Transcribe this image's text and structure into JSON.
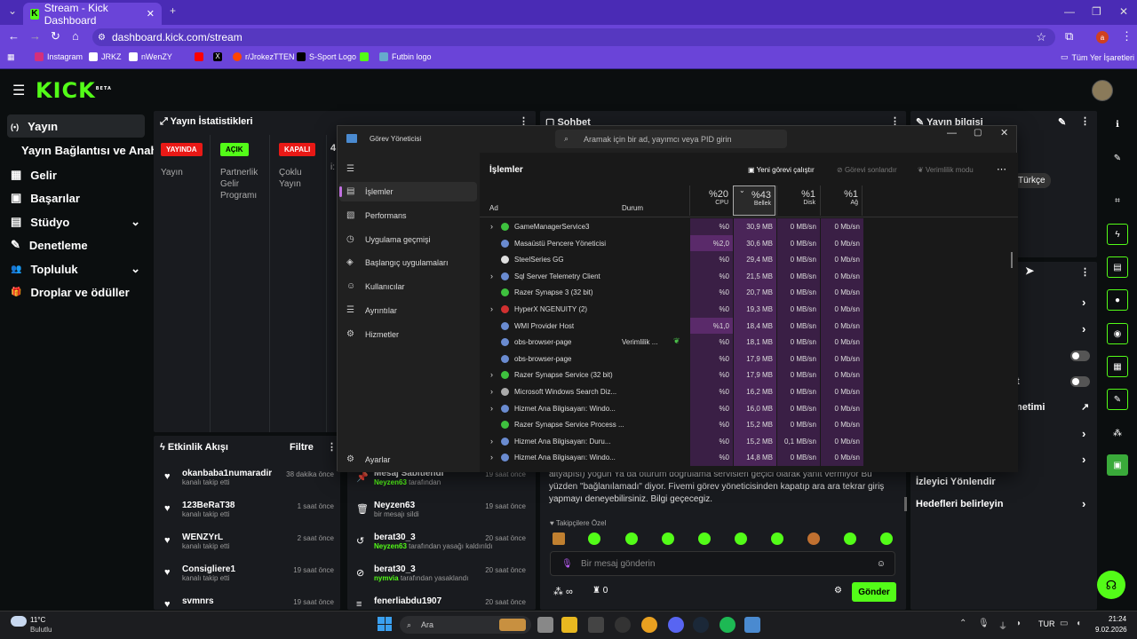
{
  "browser": {
    "tab_title": "Stream - Kick Dashboard",
    "url": "dashboard.kick.com/stream",
    "new_tab": "+",
    "bookmarks": [
      "Instagram",
      "JRKZ",
      "nWenZY",
      "",
      "r/JrokezTTEN",
      "S-Sport Logo",
      "",
      "Futbin logo"
    ],
    "all_bookmarks": "Tüm Yer İşaretleri",
    "profile_initial": "a"
  },
  "site": {
    "logo": "KICK",
    "logo_beta": "BETA"
  },
  "nav": {
    "items": [
      {
        "label": "Yayın",
        "icon": "(•)"
      },
      {
        "label": "Yayın Bağlantısı ve Anahtarı",
        "icon": ""
      },
      {
        "label": "Gelir",
        "icon": "▦"
      },
      {
        "label": "Başarılar",
        "icon": "▣"
      },
      {
        "label": "Stüdyo",
        "icon": "▤"
      },
      {
        "label": "Denetleme",
        "icon": "✎"
      },
      {
        "label": "Topluluk",
        "icon": "👥"
      },
      {
        "label": "Droplar ve ödüller",
        "icon": "🎁"
      }
    ]
  },
  "stats": {
    "title": "Yayın İstatistikleri",
    "badges": [
      {
        "label": "YAYINDA",
        "color": "#e91916"
      },
      {
        "label": "AÇIK",
        "color": "#53fc18"
      },
      {
        "label": "KAPALI",
        "color": "#e91916"
      }
    ],
    "values": [
      "4"
    ],
    "labels": [
      "Yayın",
      "Partnerlik Gelir Programı",
      "Çoklu Yayın"
    ],
    "extra": "i:"
  },
  "chat": {
    "title": "Sohbet",
    "body": "altyapısı) yoğun Ya da oturum doğrulama servisleri geçici olarak yanıt vermiyor Bu yüzden \"bağlanılamadı\" diyor. Fivemi görev yöneticisinden kapatıp ara ara tekrar giriş yapmayı deneyebilirsiniz. Bilgi geçecegiz.",
    "followers_label": "Takipçilere Özel",
    "placeholder": "Bir mesaj gönderin",
    "send": "Gönder",
    "count": "0"
  },
  "info": {
    "title": "Yayın bilgisi",
    "language": "Türkçe",
    "rows": [
      "Hedefleri belirleyin",
      "İzleyici Yönlendir",
      "netimi",
      "t"
    ]
  },
  "activity": {
    "title": "Etkinlik Akışı",
    "filter": "Filtre",
    "items": [
      {
        "name": "okanbaba1numaradir",
        "sub": "kanalı takip etti",
        "time": "38 dakika önce"
      },
      {
        "name": "123BeRaT38",
        "sub": "kanalı takip etti",
        "time": "1 saat önce"
      },
      {
        "name": "WENZYrL",
        "sub": "kanalı takip etti",
        "time": "2 saat önce"
      },
      {
        "name": "Consigliere1",
        "sub": "kanalı takip etti",
        "time": "19 saat önce"
      },
      {
        "name": "svmnrs",
        "sub": "",
        "time": "19 saat önce"
      }
    ]
  },
  "modlog": {
    "items": [
      {
        "name": "Mesaj Sabitlendi",
        "by": "Neyzen63",
        "sub": "tarafından",
        "time": "19 saat önce"
      },
      {
        "name": "Neyzen63",
        "by": "",
        "sub": "bir mesajı sildi",
        "time": "19 saat önce"
      },
      {
        "name": "berat30_3",
        "by": "Neyzen63",
        "sub": "tarafından yasağı kaldırıldı",
        "time": "20 saat önce"
      },
      {
        "name": "berat30_3",
        "by": "nymvia",
        "sub": "tarafından yasaklandı",
        "time": "20 saat önce"
      },
      {
        "name": "fenerliabdu1907",
        "by": "",
        "sub": "",
        "time": "20 saat önce"
      }
    ]
  },
  "taskmgr": {
    "title": "Görev Yöneticisi",
    "search": "Aramak için bir ad, yayımcı veya PID girin",
    "section": "İşlemler",
    "actions": [
      "Yeni görevi çalıştır",
      "Görevi sonlandır",
      "Verimlilik modu"
    ],
    "nav": [
      "İşlemler",
      "Performans",
      "Uygulama geçmişi",
      "Başlangıç uygulamaları",
      "Kullanıcılar",
      "Ayrıntılar",
      "Hizmetler"
    ],
    "settings": "Ayarlar",
    "headers": {
      "name": "Ad",
      "status": "Durum",
      "cpu_pct": "%20",
      "cpu": "CPU",
      "mem_pct": "%43",
      "mem": "Bellek",
      "disk_pct": "%1",
      "disk": "Disk",
      "net_pct": "%1",
      "net": "Ağ"
    },
    "rows": [
      {
        "name": "GameManagerService3",
        "status": "",
        "cpu": "%0",
        "mem": "30,9 MB",
        "disk": "0 MB/sn",
        "net": "0 Mb/sn",
        "exp": true,
        "ic": "#3ec13e"
      },
      {
        "name": "Masaüstü Pencere Yöneticisi",
        "status": "",
        "cpu": "%2,0",
        "mem": "30,6 MB",
        "disk": "0 MB/sn",
        "net": "0 Mb/sn",
        "exp": false,
        "ic": "#6a8bd0"
      },
      {
        "name": "SteelSeries GG",
        "status": "",
        "cpu": "%0",
        "mem": "29,4 MB",
        "disk": "0 MB/sn",
        "net": "0 Mb/sn",
        "exp": false,
        "ic": "#e0e0e0"
      },
      {
        "name": "Sql Server Telemetry Client",
        "status": "",
        "cpu": "%0",
        "mem": "21,5 MB",
        "disk": "0 MB/sn",
        "net": "0 Mb/sn",
        "exp": true,
        "ic": "#6a8bd0"
      },
      {
        "name": "Razer Synapse 3 (32 bit)",
        "status": "",
        "cpu": "%0",
        "mem": "20,7 MB",
        "disk": "0 MB/sn",
        "net": "0 Mb/sn",
        "exp": false,
        "ic": "#3ec13e"
      },
      {
        "name": "HyperX NGENUITY (2)",
        "status": "",
        "cpu": "%0",
        "mem": "19,3 MB",
        "disk": "0 MB/sn",
        "net": "0 Mb/sn",
        "exp": true,
        "ic": "#d03030"
      },
      {
        "name": "WMI Provider Host",
        "status": "",
        "cpu": "%1,0",
        "mem": "18,4 MB",
        "disk": "0 MB/sn",
        "net": "0 Mb/sn",
        "exp": false,
        "ic": "#6a8bd0"
      },
      {
        "name": "obs-browser-page",
        "status": "Verimlilik ...",
        "cpu": "%0",
        "mem": "18,1 MB",
        "disk": "0 MB/sn",
        "net": "0 Mb/sn",
        "exp": false,
        "ic": "#6a8bd0"
      },
      {
        "name": "obs-browser-page",
        "status": "",
        "cpu": "%0",
        "mem": "17,9 MB",
        "disk": "0 MB/sn",
        "net": "0 Mb/sn",
        "exp": false,
        "ic": "#6a8bd0"
      },
      {
        "name": "Razer Synapse Service (32 bit)",
        "status": "",
        "cpu": "%0",
        "mem": "17,9 MB",
        "disk": "0 MB/sn",
        "net": "0 Mb/sn",
        "exp": true,
        "ic": "#3ec13e"
      },
      {
        "name": "Microsoft Windows Search Diz...",
        "status": "",
        "cpu": "%0",
        "mem": "16,2 MB",
        "disk": "0 MB/sn",
        "net": "0 Mb/sn",
        "exp": true,
        "ic": "#aaa"
      },
      {
        "name": "Hizmet Ana Bilgisayarı: Windo...",
        "status": "",
        "cpu": "%0",
        "mem": "16,0 MB",
        "disk": "0 MB/sn",
        "net": "0 Mb/sn",
        "exp": true,
        "ic": "#6a8bd0"
      },
      {
        "name": "Razer Synapse Service Process ...",
        "status": "",
        "cpu": "%0",
        "mem": "15,2 MB",
        "disk": "0 MB/sn",
        "net": "0 Mb/sn",
        "exp": false,
        "ic": "#3ec13e"
      },
      {
        "name": "Hizmet Ana Bilgisayarı: Duru...",
        "status": "",
        "cpu": "%0",
        "mem": "15,2 MB",
        "disk": "0,1 MB/sn",
        "net": "0 Mb/sn",
        "exp": true,
        "ic": "#6a8bd0"
      },
      {
        "name": "Hizmet Ana Bilgisayarı: Windo...",
        "status": "",
        "cpu": "%0",
        "mem": "14,8 MB",
        "disk": "0 MB/sn",
        "net": "0 Mb/sn",
        "exp": true,
        "ic": "#6a8bd0"
      }
    ]
  },
  "taskbar": {
    "weather_temp": "11°C",
    "weather_desc": "Bulutlu",
    "search": "Ara",
    "lang": "TUR",
    "time": "21:24",
    "date": "9.02.2026"
  }
}
